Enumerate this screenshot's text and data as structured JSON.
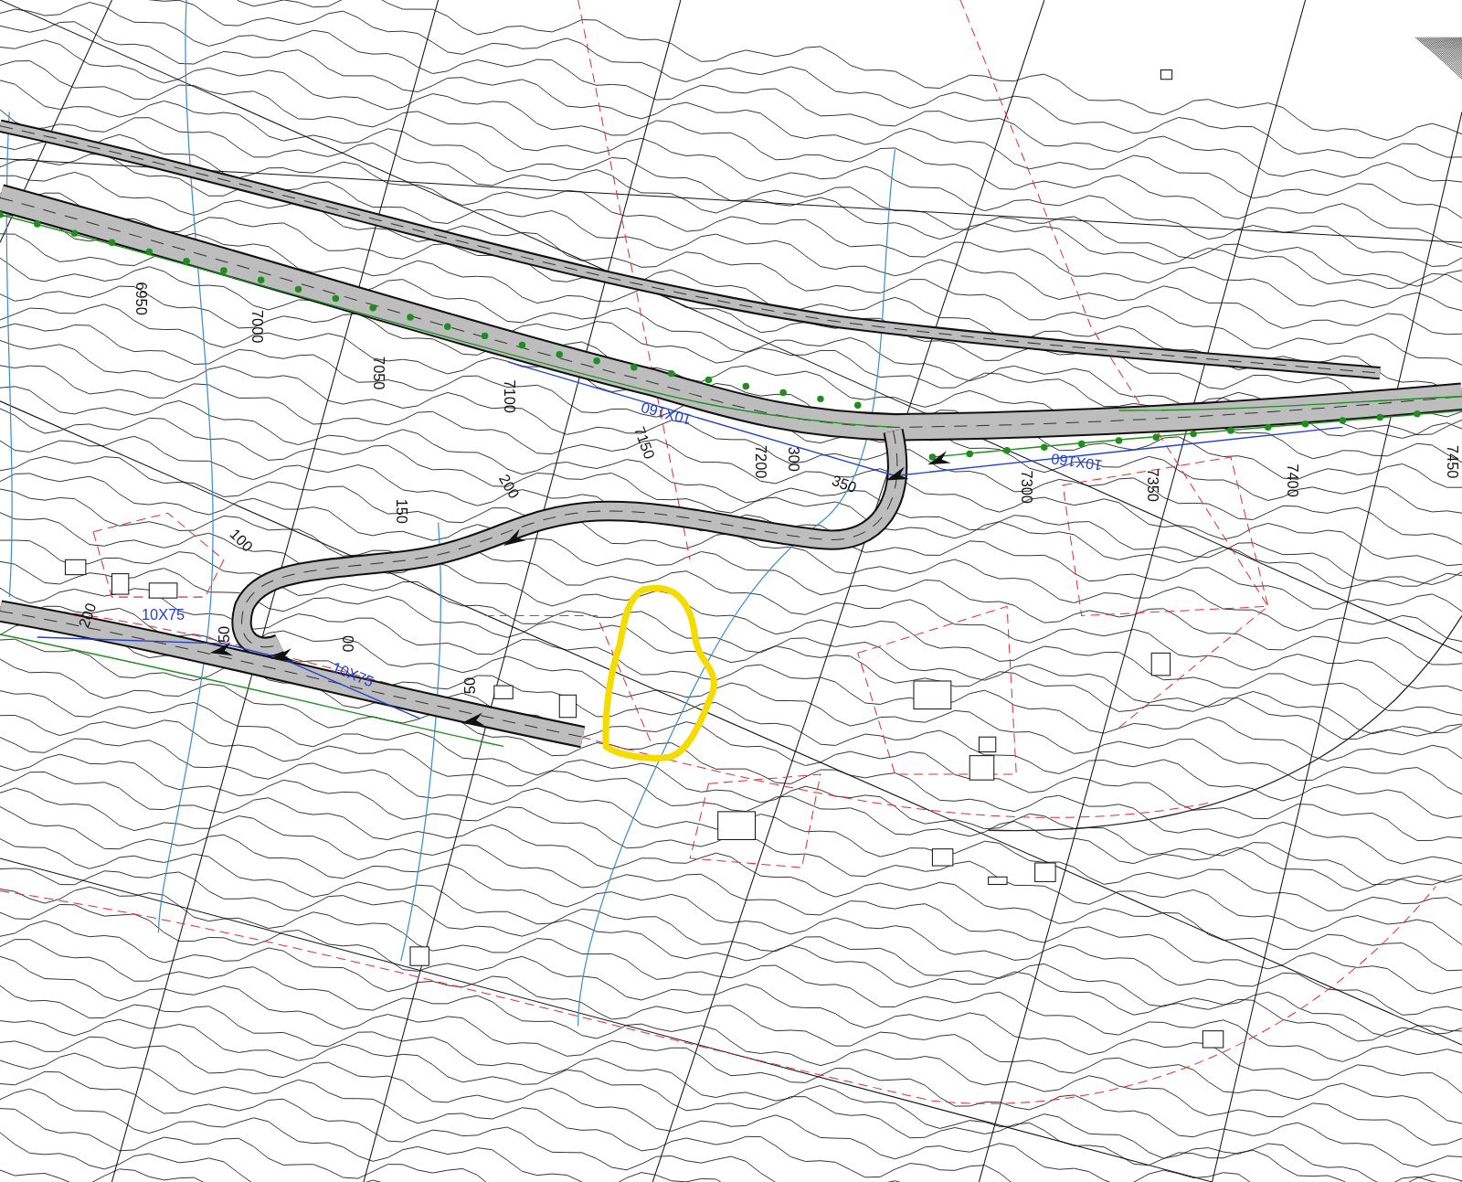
{
  "plan": {
    "labels": [
      {
        "text": "6950",
        "kind": "chainage"
      },
      {
        "text": "7000",
        "kind": "chainage"
      },
      {
        "text": "7050",
        "kind": "chainage"
      },
      {
        "text": "7100",
        "kind": "chainage"
      },
      {
        "text": "7150",
        "kind": "chainage"
      },
      {
        "text": "7200",
        "kind": "chainage"
      },
      {
        "text": "300",
        "kind": "chainage"
      },
      {
        "text": "350",
        "kind": "chainage"
      },
      {
        "text": "7300",
        "kind": "chainage"
      },
      {
        "text": "7350",
        "kind": "chainage"
      },
      {
        "text": "7400",
        "kind": "chainage"
      },
      {
        "text": "7450",
        "kind": "chainage"
      },
      {
        "text": "200",
        "kind": "chainage"
      },
      {
        "text": "150",
        "kind": "chainage"
      },
      {
        "text": "100",
        "kind": "chainage"
      },
      {
        "text": "200",
        "kind": "chainage"
      },
      {
        "text": "50",
        "kind": "chainage"
      },
      {
        "text": "00",
        "kind": "chainage"
      },
      {
        "text": "50",
        "kind": "chainage"
      },
      {
        "text": "10X160",
        "kind": "culvert"
      },
      {
        "text": "10X160",
        "kind": "culvert"
      },
      {
        "text": "10X75",
        "kind": "culvert"
      },
      {
        "text": "10X75",
        "kind": "culvert"
      }
    ]
  }
}
